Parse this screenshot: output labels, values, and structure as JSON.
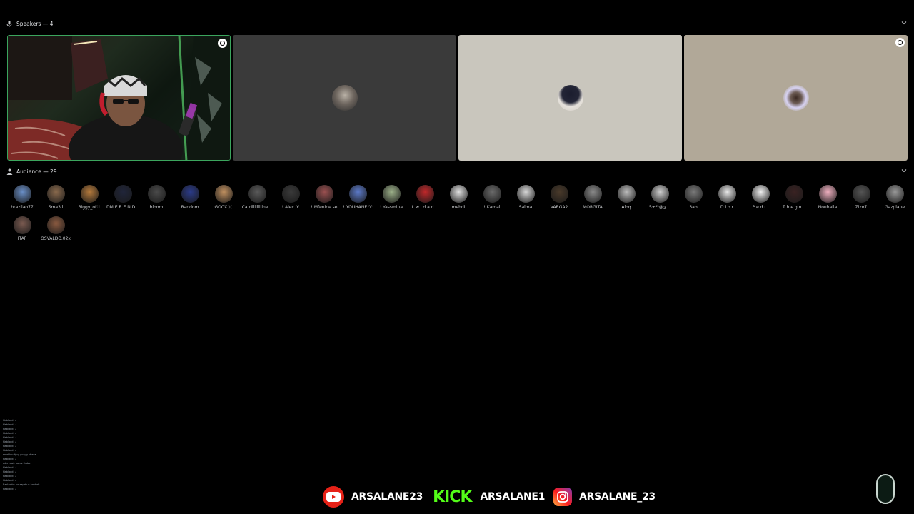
{
  "speakers": {
    "label": "Speakers — 4",
    "tiles": [
      {
        "name": "speaker-1",
        "bg": "#1b2a1c",
        "has_video": true,
        "pinned": true
      },
      {
        "name": "speaker-2",
        "bg": "#3a3a3a",
        "pinned": false
      },
      {
        "name": "speaker-3",
        "bg": "#c9c6bd",
        "pinned": false
      },
      {
        "name": "speaker-4",
        "bg": "#b1a898",
        "pinned": true
      }
    ]
  },
  "audience": {
    "label": "Audience — 29",
    "members": [
      "brazilao77",
      "Sma3il",
      "Biggy_of♡",
      "DM E R E N D...",
      "bloom",
      "Random",
      "GOOX ♊",
      "Catrilllllllllne...",
      "! Alex ♈",
      "! Mfenine se",
      "! YOUHANE ♈",
      "! Yassmina",
      "L w i d a d...",
      "mehdi",
      "! Kamal",
      "Salma",
      "VARGA2",
      "MORGITA",
      "Aloq",
      "5+ئ@⁴⁵...",
      "3ab",
      "D i o r",
      "P e d r i",
      "T h e g o...",
      "Nouhaila",
      "Zizo7",
      "Gazplane",
      "ITAF",
      "OSVALDO.02x"
    ]
  },
  "chat_lines": [
    "Hablaed: ✓",
    "Hablaed: ✓",
    "Hablaed: ✓",
    "Hablaed: ✓",
    "Hablaed: ✓",
    "Hablaed: ✓",
    "Hablaed: ✓",
    "Hablaed: ✓",
    "salahbo: fycy ycxyg ahaoa",
    "Hablaed: ✓",
    "adiz nazi: baraz lhuba",
    "Hablaed: ✓",
    "Hablaed: ✓",
    "Hablaed: ✓",
    "Hablaed: ✓",
    "Bastardo: ho zapzkuc hakkab",
    "Hablaed: ✓"
  ],
  "social": {
    "youtube": "ARSALANE23",
    "kick_logo": "KICK",
    "kick": "ARSALANE1",
    "instagram": "ARSALANE_23"
  },
  "colors": {
    "background": "#000000",
    "speaking_border": "#3ba55d",
    "youtube": "#e62117",
    "kick": "#53fc18"
  }
}
